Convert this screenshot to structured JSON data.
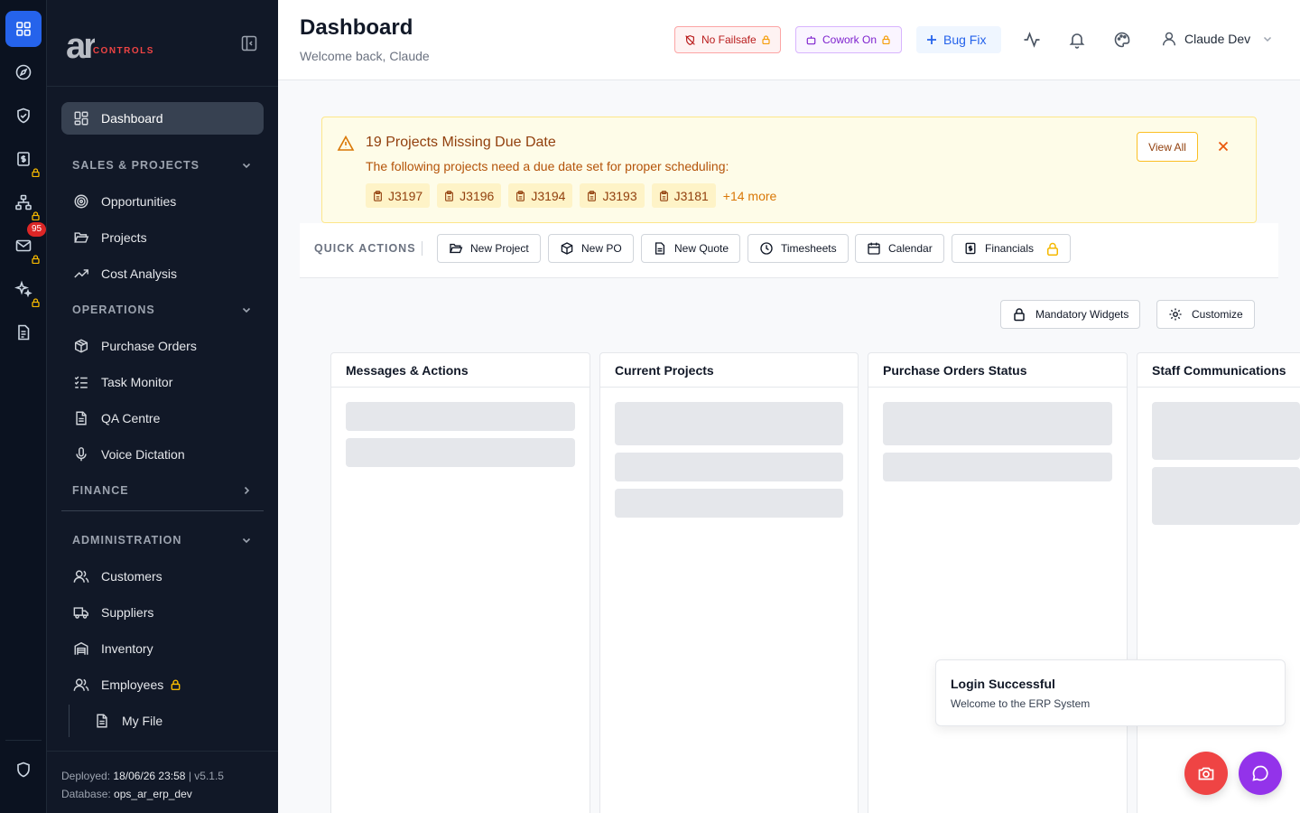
{
  "rail": {
    "badge_count": "95",
    "icons": [
      "dashboard-grid-icon",
      "compass-icon",
      "shield-check-icon",
      "dollar-file-icon",
      "sitemap-icon",
      "mail-icon",
      "sparkles-icon",
      "document-icon",
      "shield-icon"
    ]
  },
  "sidebar": {
    "logo_ar": "ar",
    "logo_controls": "CONTROLS",
    "dashboard": "Dashboard",
    "sections": {
      "sales": "SALES & PROJECTS",
      "operations": "OPERATIONS",
      "finance": "FINANCE",
      "administration": "ADMINISTRATION"
    },
    "items": {
      "opportunities": "Opportunities",
      "projects": "Projects",
      "cost_analysis": "Cost Analysis",
      "purchase_orders": "Purchase Orders",
      "task_monitor": "Task Monitor",
      "qa_centre": "QA Centre",
      "voice_dictation": "Voice Dictation",
      "customers": "Customers",
      "suppliers": "Suppliers",
      "inventory": "Inventory",
      "employees": "Employees",
      "my_file": "My File"
    },
    "footer": {
      "deployed_label": "Deployed:",
      "deployed_value": "18/06/26 23:58",
      "separator": "|",
      "version": "v5.1.5",
      "database_label": "Database:",
      "database_value": "ops_ar_erp_dev"
    }
  },
  "header": {
    "title": "Dashboard",
    "subtitle": "Welcome back, Claude",
    "failsafe": "No Failsafe",
    "cowork": "Cowork On",
    "bugfix": "Bug Fix",
    "user_name": "Claude Dev"
  },
  "alert": {
    "title": "19 Projects Missing Due Date",
    "text": "The following projects need a due date set for proper scheduling:",
    "chips": [
      "J3197",
      "J3196",
      "J3194",
      "J3193",
      "J3181"
    ],
    "more": "+14 more",
    "view_all": "View All"
  },
  "quick_actions": {
    "label": "QUICK ACTIONS",
    "new_project": "New Project",
    "new_po": "New PO",
    "new_quote": "New Quote",
    "timesheets": "Timesheets",
    "calendar": "Calendar",
    "financials": "Financials"
  },
  "widgets_bar": {
    "mandatory": "Mandatory Widgets",
    "customize": "Customize"
  },
  "widgets": {
    "messages": "Messages & Actions",
    "projects": "Current Projects",
    "purchase_orders": "Purchase Orders Status",
    "staff": "Staff Communications"
  },
  "toast": {
    "title": "Login Successful",
    "message": "Welcome to the ERP System"
  },
  "colors": {
    "accent": "#2563eb",
    "sidebar_bg": "#111827",
    "rail_bg": "#0b1220",
    "alert_bg": "#fefce8",
    "danger": "#ef4444",
    "purple": "#9333ea",
    "lock": "#f5b800"
  }
}
